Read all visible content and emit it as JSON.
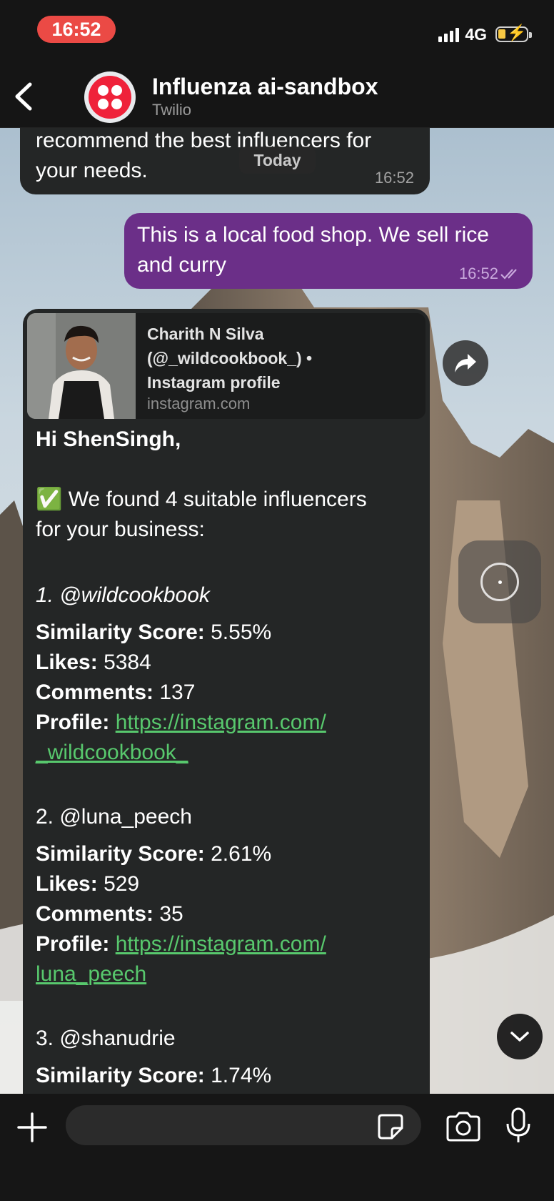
{
  "status_bar": {
    "time": "16:52",
    "network": "4G"
  },
  "header": {
    "title": "Influenza ai-sandbox",
    "subtitle": "Twilio"
  },
  "date_chip": "Today",
  "messages": [
    {
      "direction": "incoming",
      "lines": [
        "recommend the best influencers for",
        "your needs."
      ],
      "time": "16:52"
    },
    {
      "direction": "outgoing",
      "lines": [
        "This is a local food shop. We sell rice",
        "and curry"
      ],
      "time": "16:52"
    }
  ],
  "link_preview": {
    "title_lines": [
      "Charith N Silva",
      "(@_wildcookbook_) •",
      "Instagram profile"
    ],
    "domain": "instagram.com"
  },
  "result_message": {
    "greeting": "Hi ShenSingh,",
    "intro_line1": "✅ We found 4 suitable influencers",
    "intro_line2": "for your business:",
    "labels": {
      "similarity": "Similarity Score:",
      "likes": "Likes:",
      "comments": "Comments:",
      "profile": "Profile:"
    },
    "influencers": [
      {
        "heading": "1. @wildcookbook",
        "similarity": "5.55%",
        "likes": "5384",
        "comments": "137",
        "profile_line1": "https://instagram.com/",
        "profile_line2": "_wildcookbook_"
      },
      {
        "heading": "2. @luna_peech",
        "similarity": "2.61%",
        "likes": "529",
        "comments": "35",
        "profile_line1": "https://instagram.com/",
        "profile_line2": "luna_peech"
      },
      {
        "heading": "3. @shanudrie",
        "similarity": "1.74%"
      }
    ]
  },
  "composer": {
    "placeholder": ""
  },
  "colors": {
    "outgoing_bubble": "#6b2f88",
    "incoming_bubble": "#242626",
    "link": "#58c86d",
    "time_pill": "#eb4a45"
  }
}
